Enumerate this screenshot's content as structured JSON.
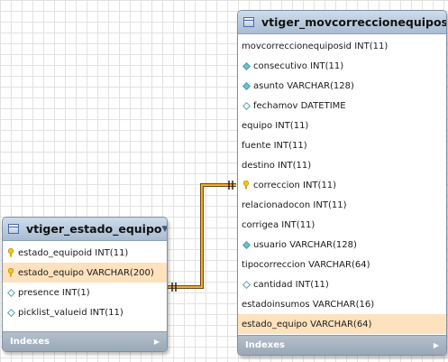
{
  "colors": {
    "selected_row": "#fde2bd",
    "relationship_line": "#e09a00",
    "header": "#b8c8dc",
    "footer": "#a4b1bf"
  },
  "tables": [
    {
      "title": "vtiger_estado_equipo",
      "footer": "Indexes",
      "columns": [
        {
          "label": "estado_equipoid INT(11)",
          "icon": "key-icon"
        },
        {
          "label": "estado_equipo VARCHAR(200)",
          "icon": "key-icon",
          "selected": true
        },
        {
          "label": "presence INT(1)",
          "icon": "diamond-icon"
        },
        {
          "label": "picklist_valueid INT(11)",
          "icon": "diamond-icon"
        }
      ]
    },
    {
      "title": "vtiger_movcorreccionequipos",
      "footer": "Indexes",
      "columns": [
        {
          "label": "movcorreccionequiposid INT(11)",
          "icon": "none"
        },
        {
          "label": "consecutivo INT(11)",
          "icon": "diamond-filled-icon"
        },
        {
          "label": "asunto VARCHAR(128)",
          "icon": "diamond-filled-icon"
        },
        {
          "label": "fechamov DATETIME",
          "icon": "diamond-icon"
        },
        {
          "label": "equipo INT(11)",
          "icon": "none"
        },
        {
          "label": "fuente INT(11)",
          "icon": "none"
        },
        {
          "label": "destino INT(11)",
          "icon": "none"
        },
        {
          "label": "correccion INT(11)",
          "icon": "key-icon"
        },
        {
          "label": "relacionadocon INT(11)",
          "icon": "none"
        },
        {
          "label": "corrigea INT(11)",
          "icon": "none"
        },
        {
          "label": "usuario VARCHAR(128)",
          "icon": "diamond-filled-icon"
        },
        {
          "label": "tipocorreccion VARCHAR(64)",
          "icon": "none"
        },
        {
          "label": "cantidad INT(11)",
          "icon": "diamond-icon"
        },
        {
          "label": "estadoinsumos VARCHAR(16)",
          "icon": "none"
        },
        {
          "label": "estado_equipo VARCHAR(64)",
          "icon": "none",
          "selected": true
        }
      ]
    }
  ]
}
